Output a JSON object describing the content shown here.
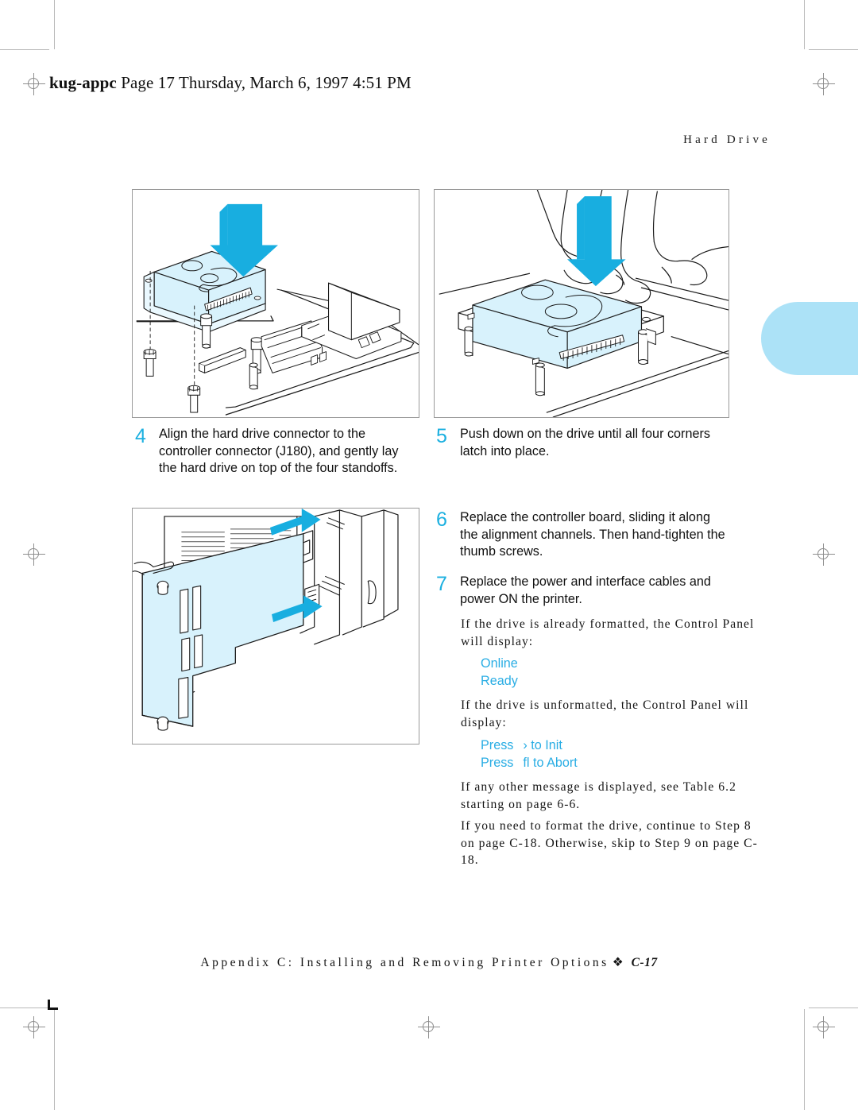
{
  "file_stamp": {
    "filename": "kug-appc",
    "rest": "Page 17  Thursday, March 6, 1997  4:51 PM"
  },
  "running_head": "Hard  Drive",
  "colors": {
    "accent_cyan": "#1cb0e0",
    "arrow_cyan": "#18aee0",
    "part_fill": "#d8f2fc",
    "tab_blue": "#ace2f7",
    "frame_gray": "#9a9a9a"
  },
  "figures": [
    {
      "name": "hard-drive-align-figure",
      "caption_step": "4",
      "alt": "Hard drive being lowered onto controller board standoffs with downward arrow"
    },
    {
      "name": "hard-drive-press-figure",
      "caption_step": "5",
      "alt": "Hand pressing down on hard drive until corners latch, with downward arrow"
    },
    {
      "name": "controller-board-install-figure",
      "caption_step": "6",
      "alt": "Controller board sliding into printer rear along alignment channels with two arrows"
    }
  ],
  "steps": [
    {
      "number": "4",
      "text": "Align the hard drive connector to the controller connector (J180), and gently lay the hard drive on top of the four standoffs."
    },
    {
      "number": "5",
      "text": "Push down on the drive until all four corners latch into place."
    },
    {
      "number": "6",
      "text": "Replace the controller board, sliding it along the alignment channels. Then hand-tighten the thumb screws."
    },
    {
      "number": "7",
      "text": "Replace the power and interface cables and power ON the printer."
    }
  ],
  "notes": {
    "formatted_intro": "If the drive is already formatted, the Control Panel will display:",
    "unformatted_intro": "If the drive is unformatted, the Control Panel will display:",
    "other_message": "If any other message is displayed, see Table 6.2 starting on page 6-6.",
    "format_continue": "If you need to format the drive, continue to Step 8 on page C-18. Otherwise, skip to Step 9 on page C-18."
  },
  "panel_messages": {
    "formatted": [
      "Online",
      "Ready"
    ],
    "unformatted": [
      {
        "prefix": "Press",
        "key": "›",
        "suffix": "to Init"
      },
      {
        "prefix": "Press",
        "key": "fl",
        "suffix": "to Abort"
      }
    ]
  },
  "footer": {
    "text": "Appendix C: Installing and Removing Printer Options",
    "separator": "❖",
    "folio": "C-17"
  }
}
